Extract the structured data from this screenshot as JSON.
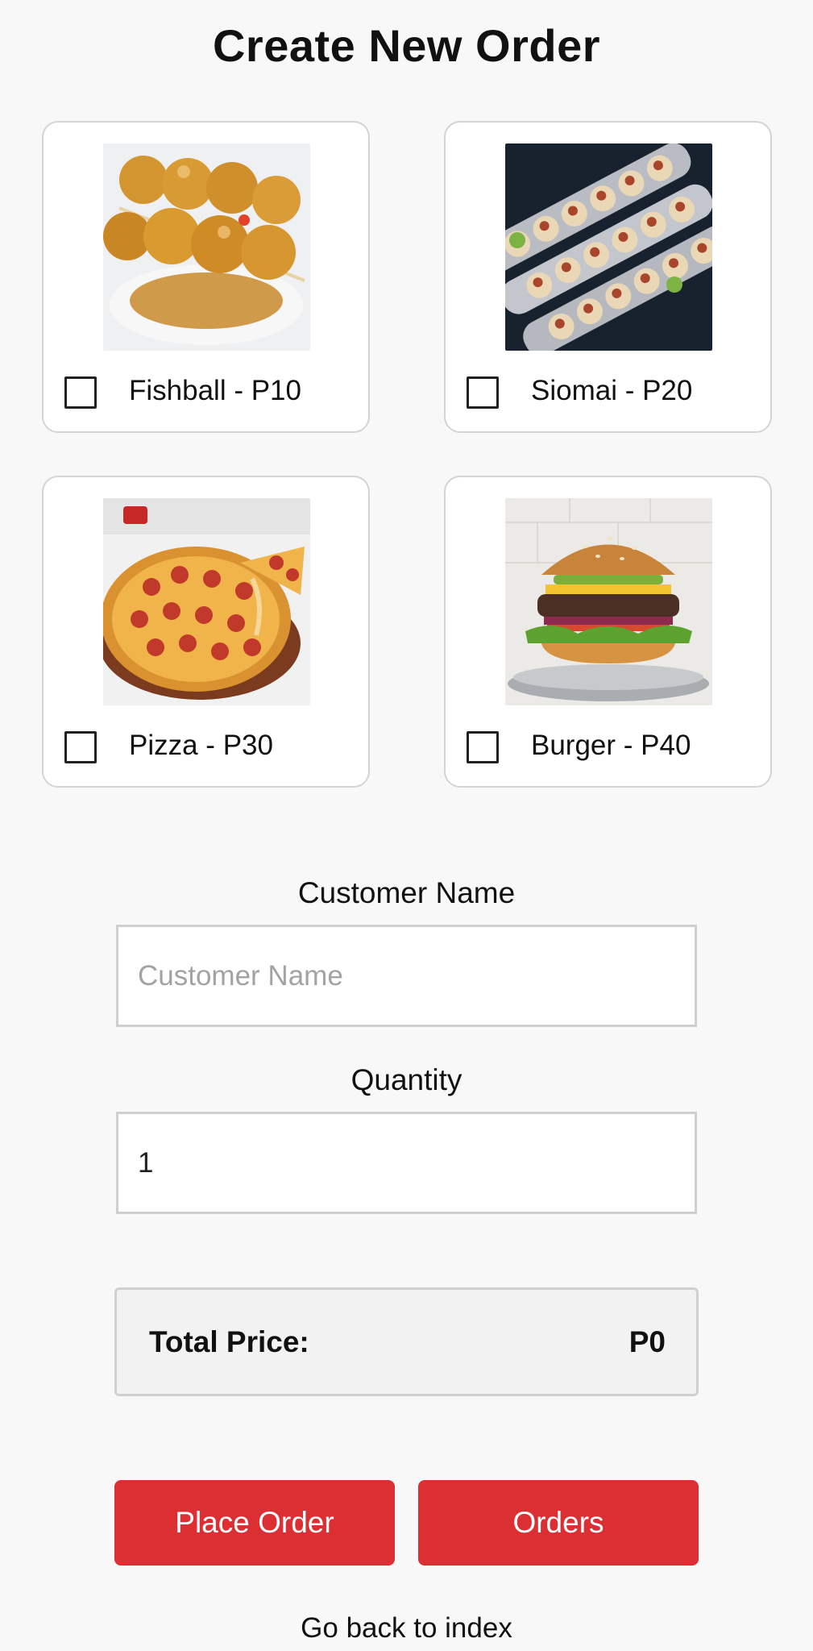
{
  "page": {
    "title": "Create New Order"
  },
  "items": [
    {
      "label": "Fishball - P10",
      "checked": false,
      "image": "fishball-photo"
    },
    {
      "label": "Siomai - P20",
      "checked": false,
      "image": "siomai-photo"
    },
    {
      "label": "Pizza - P30",
      "checked": false,
      "image": "pizza-photo"
    },
    {
      "label": "Burger - P40",
      "checked": false,
      "image": "burger-photo"
    }
  ],
  "form": {
    "customer_name_label": "Customer Name",
    "customer_name_placeholder": "Customer Name",
    "customer_name_value": "",
    "quantity_label": "Quantity",
    "quantity_value": "1"
  },
  "total": {
    "label": "Total Price:",
    "value": "P0"
  },
  "buttons": {
    "place_order": "Place Order",
    "orders": "Orders"
  },
  "footer": {
    "back_link": "Go back to index"
  },
  "colors": {
    "accent": "#dc2f33",
    "border": "#d4d4d4",
    "total_bg": "#f2f2f2"
  }
}
